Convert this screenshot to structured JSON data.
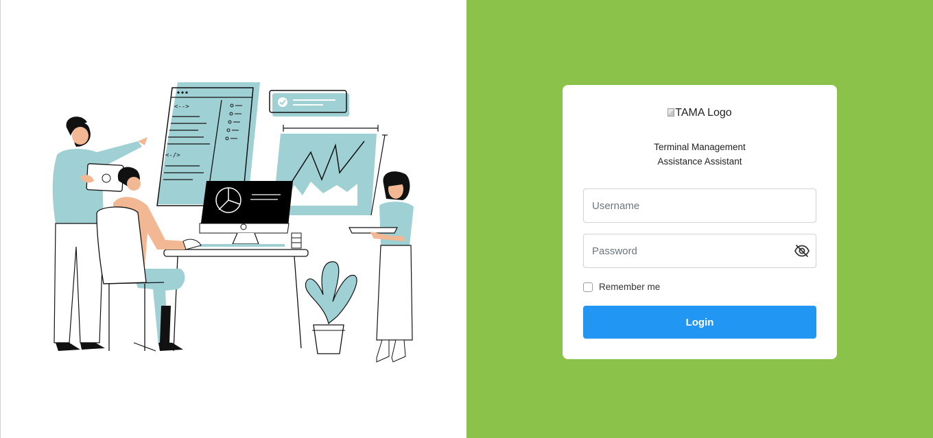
{
  "brand": {
    "logo_alt": "TAMA Logo",
    "subtitle_line1": "Terminal Management",
    "subtitle_line2": "Assistance Assistant"
  },
  "form": {
    "username_placeholder": "Username",
    "username_value": "",
    "password_placeholder": "Password",
    "password_value": "",
    "password_toggle_icon": "eye-slash-icon",
    "remember_label": "Remember me",
    "remember_checked": false,
    "login_label": "Login"
  },
  "illustration": {
    "subject": "team-working-on-dashboard"
  },
  "colors": {
    "right_background": "#8bc34a",
    "primary_button": "#2196f3",
    "illustration_accent": "#9fd0d4"
  }
}
